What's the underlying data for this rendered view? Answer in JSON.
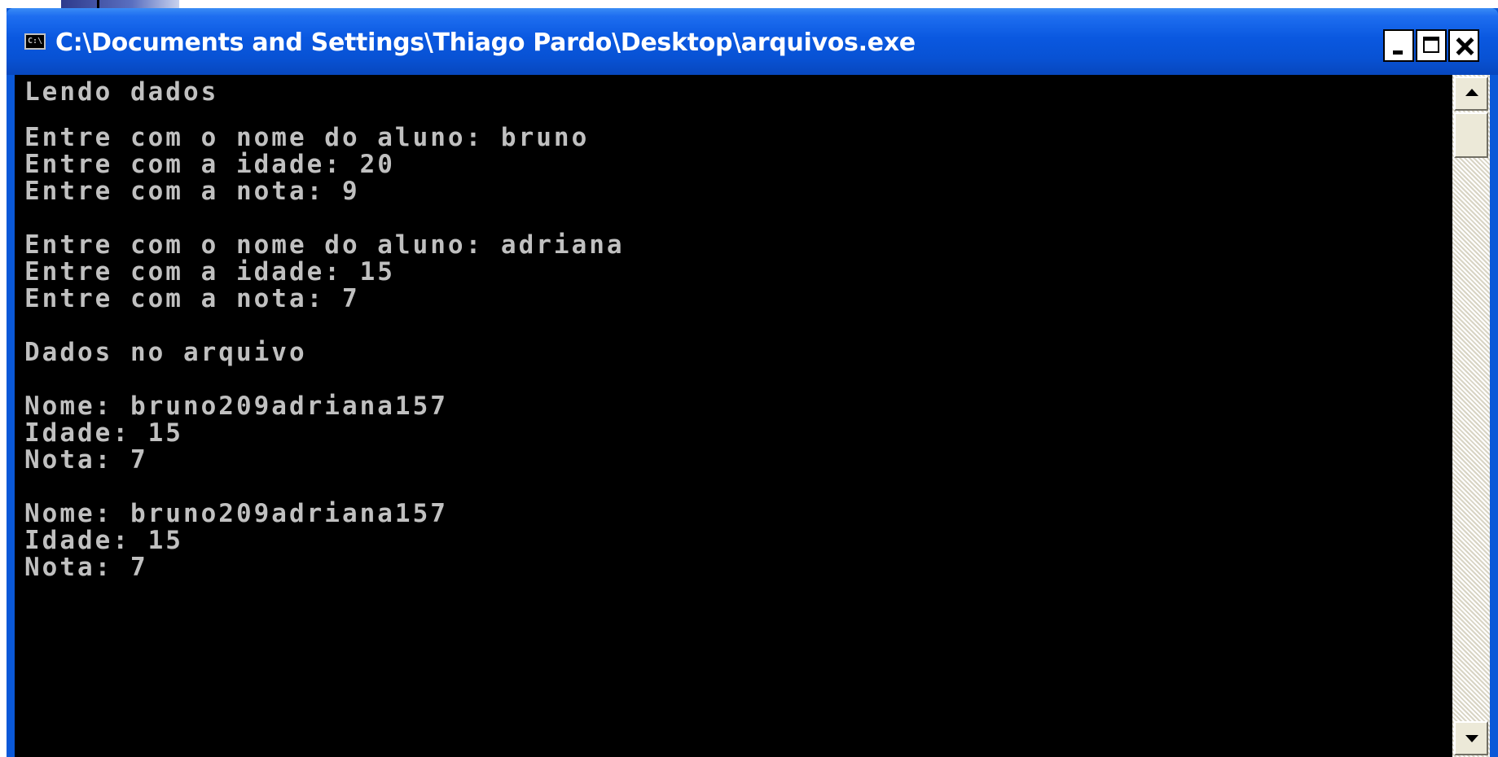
{
  "window": {
    "title": "C:\\Documents and Settings\\Thiago Pardo\\Desktop\\arquivos.exe",
    "icon_name": "console-app-icon",
    "icon_glyph": "C:\\",
    "buttons": {
      "minimize": "minimize-icon",
      "maximize": "maximize-icon",
      "close": "close-icon"
    }
  },
  "console": {
    "background": "#000000",
    "text_color": "#c0c0c0",
    "lines": [
      "Lendo dados",
      "",
      "Entre com o nome do aluno: bruno",
      "Entre com a idade: 20",
      "Entre com a nota: 9",
      "",
      "Entre com o nome do aluno: adriana",
      "Entre com a idade: 15",
      "Entre com a nota: 7",
      "",
      "Dados no arquivo",
      "",
      "Nome: bruno209adriana157",
      "Idade: 15",
      "Nota: 7",
      "",
      "Nome: bruno209adriana157",
      "Idade: 15",
      "Nota: 7"
    ]
  },
  "colors": {
    "titlebar": "#0a58e0",
    "window_frame": "#0a58d8",
    "scrollbar_track": "#ece9d8"
  }
}
